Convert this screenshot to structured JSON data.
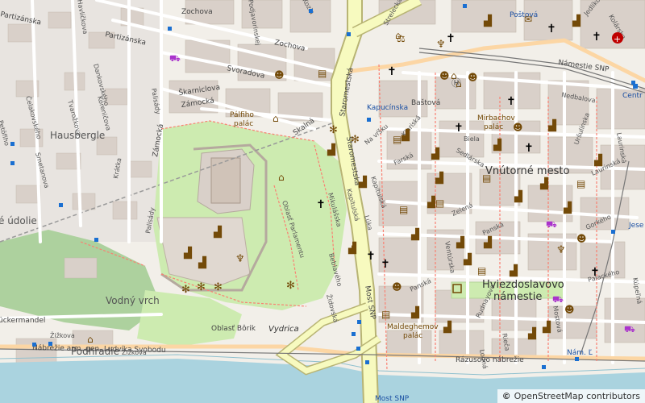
{
  "map": {
    "place_labels": {
      "hausbergle": "Hausbergle",
      "udolie": "é údolie",
      "vodny_vrch": "Vodný vrch",
      "podhradie": "Podhradie",
      "vnutorne_mesto": "Vnútorné mesto",
      "hviezdoslavovo": "Hviezdoslavovo",
      "namestie": "námestie",
      "palfiho": "Pálfiho",
      "palac": "palác",
      "kapucinska": "Kapucínska",
      "mirbachov": "Mirbachov",
      "mirbachov_palac": "palác",
      "maldeghemov": "Maldeghemov",
      "maldeghemov_palac": "palác",
      "oblast_borik": "Oblasť Bôrik",
      "vydrica": "Vydrica",
      "oblast_parlamentu": "Oblasť Parlamentu",
      "uckermandel": "ückermandel",
      "most_snp": "Most SNP",
      "most_snp_bottom": "Most SNP",
      "postova": "Poštová",
      "centr": "Centr",
      "jese": "Jese",
      "nam_l": "Nám. Ľ"
    },
    "streets": {
      "zochova_top": "Zochova",
      "zochova_mid": "Zochova",
      "partizanska_a": "Partizánska",
      "partizanska_b": "Partizánska",
      "svoradova": "Svoradova",
      "skarniclova": "Škarniclova",
      "zamocka": "Zámocká",
      "zamocka_west": "Zámocká",
      "skalna": "Skalná",
      "staromestska_a": "Staromestská",
      "staromestska_b": "Staromestská",
      "kapucinska": "Kapucínska",
      "bastova": "Baštová",
      "klariska": "Klariská",
      "na_vrsku": "Na vŕšku",
      "farska": "Farská",
      "kapitulska": "Kapitulská",
      "biela": "Biela",
      "sedlarska": "Sedlárska",
      "zelena": "Zelená",
      "venturska": "Ventúrska",
      "panska_a": "Panská",
      "panska_b": "Panská",
      "gorkeho": "Gorkého",
      "laurinska": "Laurinská",
      "urxulinska": "Uršulínska",
      "nedbalova": "Nedbalova",
      "namestie_snp": "Námestie SNP",
      "kolarska": "Kolárska",
      "jedlikova": "Jedlíkova",
      "palackeho": "Palackého",
      "kupelna": "Kúpeľná",
      "mostova": "Mostová",
      "laurinska_b": "Laurinská",
      "rudnayova": "Rudnayovo",
      "lodna": "Lodná",
      "rieca": "Rieča",
      "razusovo": "Rázusovo nábrežie",
      "nabrezie": "Nábrežie arm. gen. Ludvíka Svobodu",
      "zizkova_a": "Žižkova",
      "zizkova_b": "Žižkova",
      "zidovska": "Židovská",
      "beblavého": "Beblavého",
      "mikulasska": "Mikulášska",
      "luka": "Lúka",
      "kapitulska_b": "Kapitulská",
      "palisady_a": "Palisády",
      "palisady_b": "Palisády",
      "krakva": "Krátka",
      "smetanova": "Smetanova",
      "celakovskeho": "Čelakovského",
      "tvarozkova": "Tvarožkova",
      "dankovskeho": "Dankovského",
      "korenicova": "Koreničova",
      "petroviceva": "Petöfiho",
      "havlickova": "Havlíčkova",
      "podjavorinskej": "Podjavorinskej",
      "strelecka": "Strelecká",
      "kozia": "Kozia"
    }
  },
  "attribution": {
    "copyright": "©",
    "text": "OpenStreetMap contributors"
  },
  "colors": {
    "background": "#f2efe9",
    "building": "#d9d0c9",
    "park": "#cdebb0",
    "forest": "#add19e",
    "water": "#aad3df",
    "road_major": "#f7fabf",
    "road_major_border": "#b8b474",
    "road_primary": "#fcd6a4",
    "railway": "#999999",
    "poi_brown": "#734a08",
    "bus_stop": "#1a6fd1",
    "pedestrian": "#ddd9e8"
  }
}
